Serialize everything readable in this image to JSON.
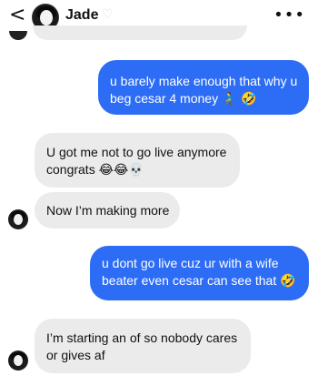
{
  "header": {
    "back_icon": "chevron-left-icon",
    "back_glyph": "<",
    "contact_name": "Jade",
    "heart_glyph": "♡",
    "more_glyph": "•••"
  },
  "messages": [
    {
      "direction": "outgoing",
      "lines": [
        "u barely make enough that why u",
        "beg cesar 4 money 🧎‍♂️ 🤣"
      ]
    },
    {
      "direction": "incoming",
      "lines": [
        "U got me not to go live anymore",
        "congrats 😂😂💀"
      ]
    },
    {
      "direction": "incoming",
      "lines": [
        "Now I’m making more"
      ]
    },
    {
      "direction": "outgoing",
      "lines": [
        "u dont go live cuz ur with a wife",
        "beater even cesar can see that 🤣"
      ]
    },
    {
      "direction": "incoming",
      "lines": [
        "I’m starting an of so nobody cares",
        "or gives af"
      ]
    }
  ],
  "colors": {
    "outgoing_bubble": "#2d6df5",
    "incoming_bubble": "#ebebeb",
    "background": "#ffffff"
  }
}
